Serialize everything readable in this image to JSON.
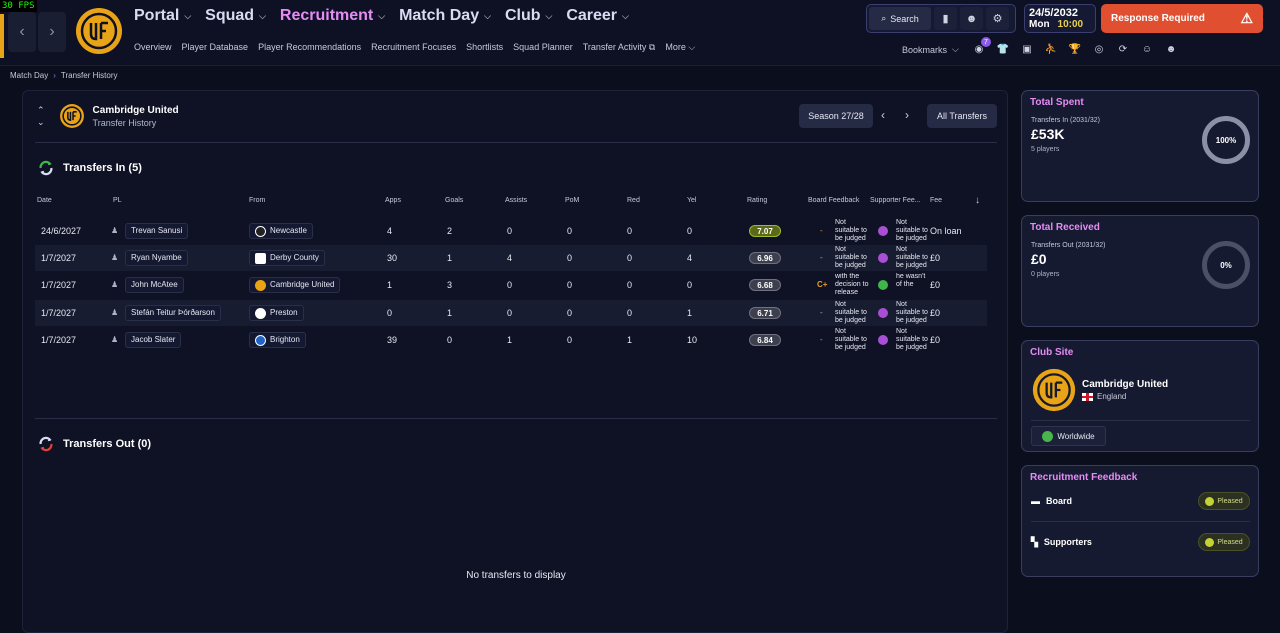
{
  "fps": "30 FPS",
  "nav": {
    "main": [
      {
        "label": "Portal",
        "active": false
      },
      {
        "label": "Squad",
        "active": false
      },
      {
        "label": "Recruitment",
        "active": true
      },
      {
        "label": "Match Day",
        "active": false
      },
      {
        "label": "Club",
        "active": false
      },
      {
        "label": "Career",
        "active": false
      }
    ],
    "sub": [
      "Overview",
      "Player Database",
      "Player Recommendations",
      "Recruitment Focuses",
      "Shortlists",
      "Squad Planner",
      "Transfer Activity",
      "More"
    ]
  },
  "toolbar": {
    "search_label": "Search"
  },
  "date": {
    "date": "24/5/2032",
    "day": "Mon",
    "time": "10:00"
  },
  "response": {
    "label": "Response Required"
  },
  "bookmarks": {
    "label": "Bookmarks",
    "badge": "7"
  },
  "breadcrumb": [
    "Match Day",
    "Transfer History"
  ],
  "club": {
    "name": "Cambridge United",
    "subtitle": "Transfer History"
  },
  "season": {
    "label": "Season 27/28",
    "filter": "All Transfers"
  },
  "transfers_in": {
    "title": "Transfers In (5)",
    "columns": [
      "Date",
      "PL",
      "From",
      "Apps",
      "Goals",
      "Assists",
      "PoM",
      "Red",
      "Yel",
      "Rating",
      "Board Feedback",
      "Supporter Fee...",
      "Fee"
    ],
    "rows": [
      {
        "date": "24/6/2027",
        "name": "Trevan Sanusi",
        "club": "Newcastle",
        "apps": "4",
        "goals": "2",
        "assists": "0",
        "pom": "0",
        "red": "0",
        "yel": "0",
        "rating": "7.07",
        "board_grade": "-",
        "board_text": "Not suitable to be judged",
        "supp_text": "Not suitable to be judged",
        "fee": "On loan"
      },
      {
        "date": "1/7/2027",
        "name": "Ryan Nyambe",
        "club": "Derby County",
        "apps": "30",
        "goals": "1",
        "assists": "4",
        "pom": "0",
        "red": "0",
        "yel": "4",
        "rating": "6.96",
        "board_grade": "-",
        "board_text": "Not suitable to be judged",
        "supp_text": "Not suitable to be judged released",
        "fee": "£0"
      },
      {
        "date": "1/7/2027",
        "name": "John McAtee",
        "club": "Cambridge United",
        "apps": "1",
        "goals": "3",
        "assists": "0",
        "pom": "0",
        "red": "0",
        "yel": "0",
        "rating": "6.68",
        "board_grade": "C+",
        "board_text": "with the decision to release",
        "supp_text": "he wasn't of the",
        "fee": "£0"
      },
      {
        "date": "1/7/2027",
        "name": "Stefán Teitur Þórðarson",
        "club": "Preston",
        "apps": "0",
        "goals": "1",
        "assists": "0",
        "pom": "0",
        "red": "0",
        "yel": "1",
        "rating": "6.71",
        "board_grade": "-",
        "board_text": "Not suitable to be judged",
        "supp_text": "Not suitable to be judged",
        "fee": "£0"
      },
      {
        "date": "1/7/2027",
        "name": "Jacob Slater",
        "club": "Brighton",
        "apps": "39",
        "goals": "0",
        "assists": "1",
        "pom": "0",
        "red": "1",
        "yel": "10",
        "rating": "6.84",
        "board_grade": "-",
        "board_text": "Not suitable to be judged",
        "supp_text": "Not suitable to be judged",
        "fee": "£0"
      }
    ]
  },
  "transfers_out": {
    "title": "Transfers Out (0)",
    "empty": "No transfers to display"
  },
  "total_spent": {
    "title": "Total Spent",
    "label": "Transfers In (2031/32)",
    "value": "£53K",
    "players": "5 players",
    "percent": "100%"
  },
  "total_received": {
    "title": "Total Received",
    "label": "Transfers Out (2031/32)",
    "value": "£0",
    "players": "0 players",
    "percent": "0%"
  },
  "club_site": {
    "title": "Club Site",
    "name": "Cambridge United",
    "country": "England",
    "scope": "Worldwide"
  },
  "recruitment_feedback": {
    "title": "Recruitment Feedback",
    "rows": [
      {
        "label": "Board",
        "status": "Pleased"
      },
      {
        "label": "Supporters",
        "status": "Pleased"
      }
    ]
  },
  "colors": {
    "accent": "#e58cf5",
    "response": "#e04f30",
    "crest": "#e8a317",
    "good_rating": "#5a6a17"
  }
}
